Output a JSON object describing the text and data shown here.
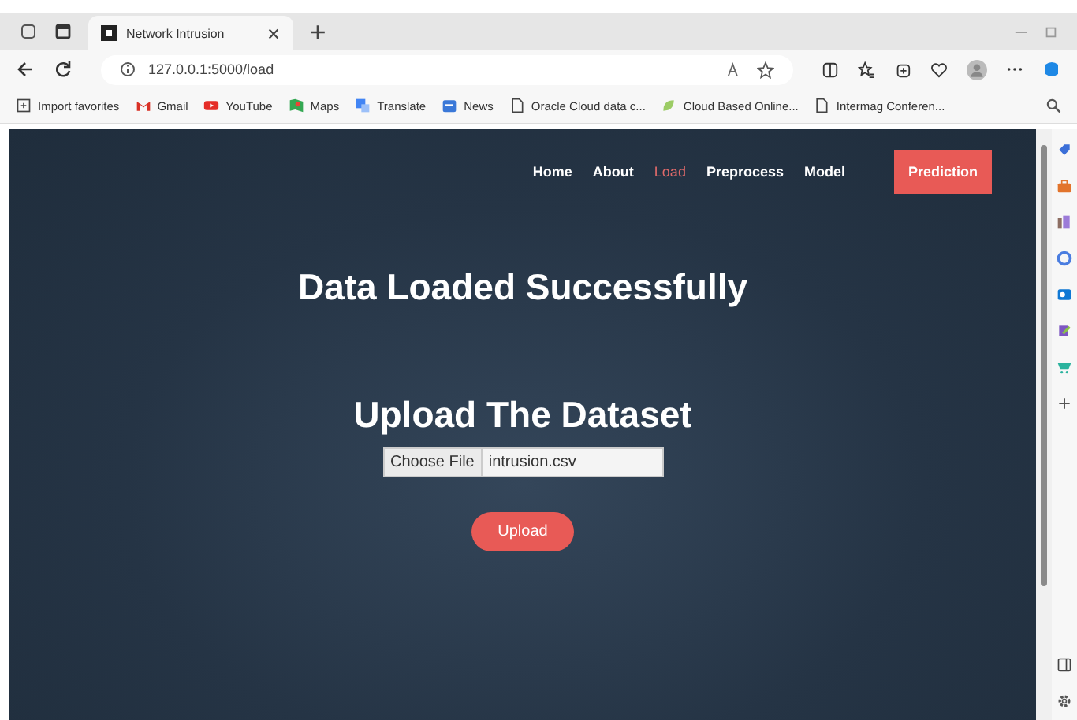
{
  "browser": {
    "tab_title": "Network Intrusion",
    "address": "127.0.0.1:5000/load",
    "bookmarks": [
      {
        "label": "Import favorites",
        "kind": "import"
      },
      {
        "label": "Gmail",
        "kind": "gmail"
      },
      {
        "label": "YouTube",
        "kind": "youtube"
      },
      {
        "label": "Maps",
        "kind": "maps"
      },
      {
        "label": "Translate",
        "kind": "translate"
      },
      {
        "label": "News",
        "kind": "news"
      },
      {
        "label": "Oracle Cloud data c...",
        "kind": "page"
      },
      {
        "label": "Cloud Based Online...",
        "kind": "leaf"
      },
      {
        "label": "Intermag Conferen...",
        "kind": "page"
      }
    ]
  },
  "nav": {
    "links": [
      {
        "label": "Home",
        "selected": false
      },
      {
        "label": "About",
        "selected": false
      },
      {
        "label": "Load",
        "selected": true
      },
      {
        "label": "Preprocess",
        "selected": false
      },
      {
        "label": "Model",
        "selected": false
      }
    ],
    "cta": "Prediction"
  },
  "status_message": "Data Loaded Successfully",
  "upload": {
    "heading": "Upload The Dataset",
    "file_button": "Choose File",
    "file_name": "intrusion.csv",
    "submit": "Upload"
  }
}
